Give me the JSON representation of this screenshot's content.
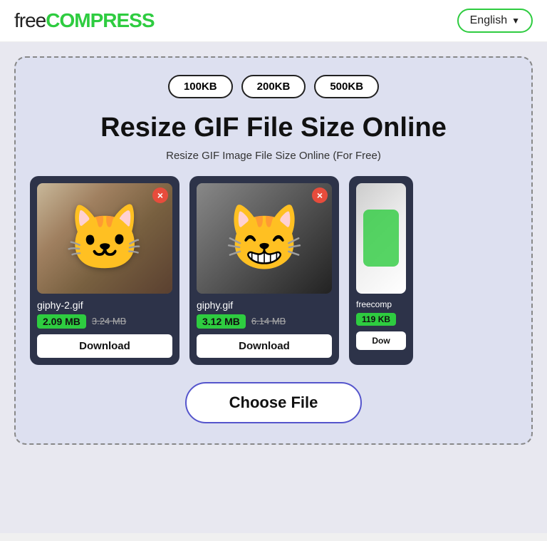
{
  "header": {
    "logo_free": "free",
    "logo_compress": "COMPRESS",
    "lang_label": "English",
    "lang_chevron": "▼"
  },
  "size_buttons": [
    "100KB",
    "200KB",
    "500KB"
  ],
  "page_title": "Resize GIF File Size Online",
  "page_subtitle": "Resize GIF Image File Size Online (For Free)",
  "cards": [
    {
      "filename": "giphy-2.gif",
      "size_new": "2.09 MB",
      "size_old": "3.24 MB",
      "download_label": "Download",
      "close_label": "×",
      "type": "cat1"
    },
    {
      "filename": "giphy.gif",
      "size_new": "3.12 MB",
      "size_old": "6.14 MB",
      "download_label": "Download",
      "close_label": "×",
      "type": "cat2"
    },
    {
      "filename": "freecomp",
      "size_new": "119 KB",
      "size_old": "",
      "download_label": "Dow",
      "close_label": "×",
      "type": "partial"
    }
  ],
  "choose_file_label": "Choose File"
}
